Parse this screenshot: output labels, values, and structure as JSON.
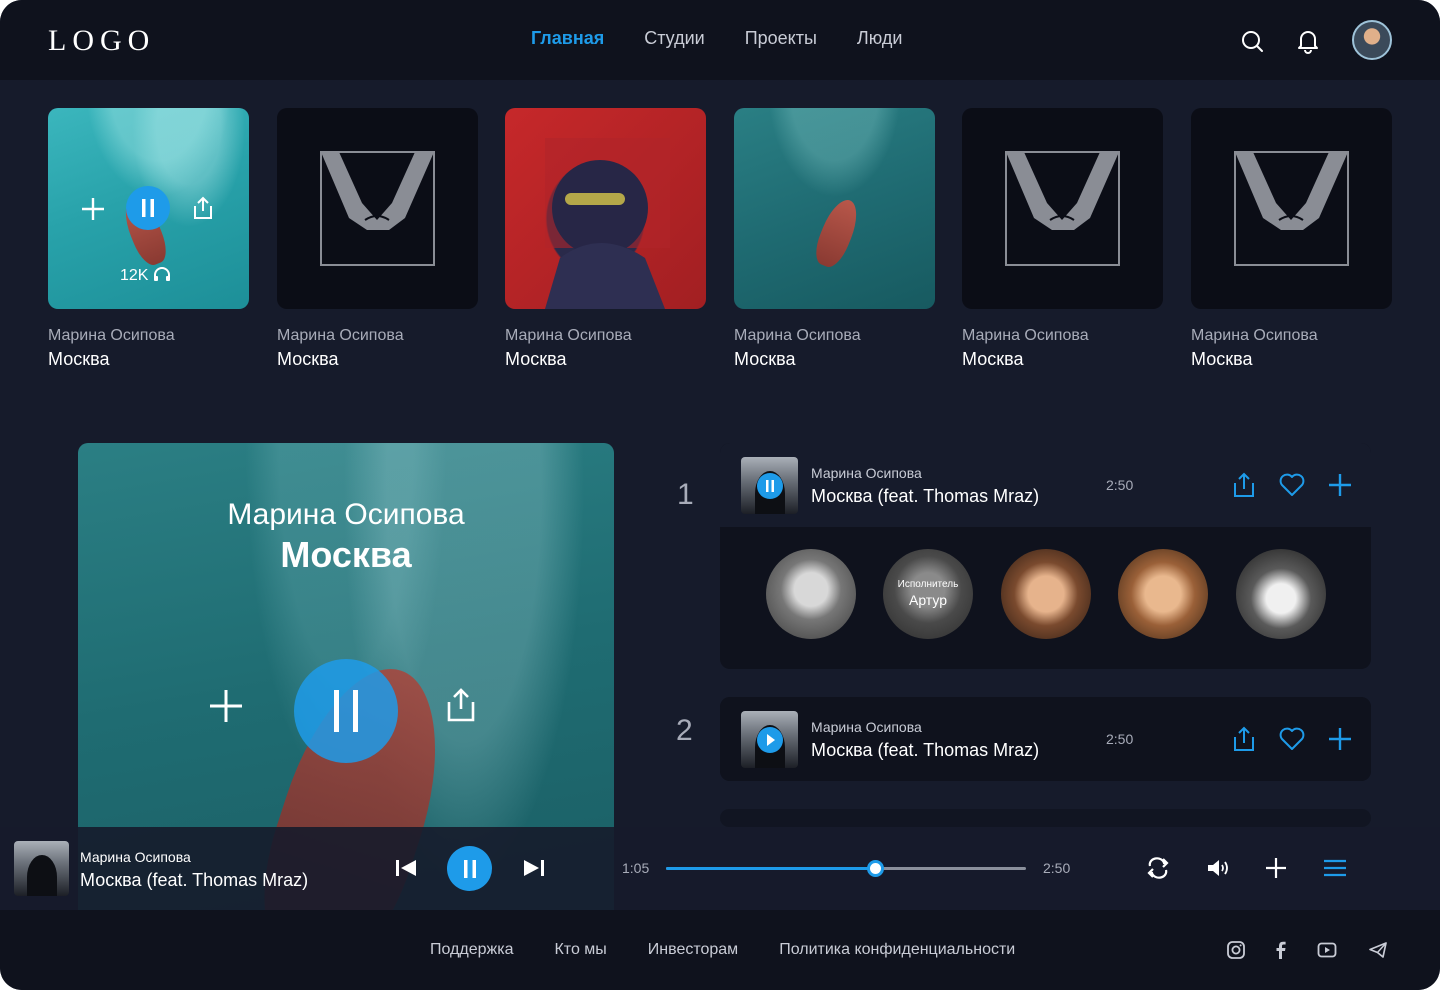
{
  "header": {
    "logo": "LOGO",
    "nav": [
      {
        "label": "Главная",
        "active": true
      },
      {
        "label": "Студии",
        "active": false
      },
      {
        "label": "Проекты",
        "active": false
      },
      {
        "label": "Люди",
        "active": false
      }
    ],
    "icons": [
      "search-icon",
      "bell-icon",
      "avatar"
    ]
  },
  "cards": [
    {
      "artist": "Марина Осипова",
      "city": "Москва",
      "art": "sea-boat",
      "playing": true,
      "listens": "12K"
    },
    {
      "artist": "Марина Осипова",
      "city": "Москва",
      "art": "hands-outline"
    },
    {
      "artist": "Марина Осипова",
      "city": "Москва",
      "art": "red-portrait"
    },
    {
      "artist": "Марина Осипова",
      "city": "Москва",
      "art": "sea-boat-dark"
    },
    {
      "artist": "Марина Осипова",
      "city": "Москва",
      "art": "hands-outline"
    },
    {
      "artist": "Марина Осипова",
      "city": "Москва",
      "art": "hands-outline"
    }
  ],
  "featured": {
    "artist": "Марина Осипова",
    "song": "Москва"
  },
  "tracks": [
    {
      "number": "1",
      "artist": "Марина Осипова",
      "song": "Москва (feat. Thomas Mraz)",
      "duration": "2:50",
      "state": "playing",
      "performers": [
        {
          "name": "",
          "role": ""
        },
        {
          "name": "Артур",
          "role": "Исполнитель"
        },
        {
          "name": "",
          "role": ""
        },
        {
          "name": "",
          "role": ""
        },
        {
          "name": "",
          "role": ""
        }
      ]
    },
    {
      "number": "2",
      "artist": "Марина Осипова",
      "song": "Москва (feat. Thomas Mraz)",
      "duration": "2:50",
      "state": "paused"
    }
  ],
  "player": {
    "artist": "Марина Осипова",
    "song": "Москва (feat. Thomas Mraz)",
    "current_time": "1:05",
    "total_time": "2:50",
    "progress": 0.58
  },
  "footer": {
    "links": [
      "Поддержка",
      "Кто мы",
      "Инвесторам",
      "Политика конфиденциальности"
    ],
    "social": [
      "instagram-icon",
      "facebook-icon",
      "youtube-icon",
      "telegram-icon"
    ]
  },
  "colors": {
    "accent": "#1e9be9",
    "background": "#161b2b",
    "panel": "#0f121d"
  }
}
